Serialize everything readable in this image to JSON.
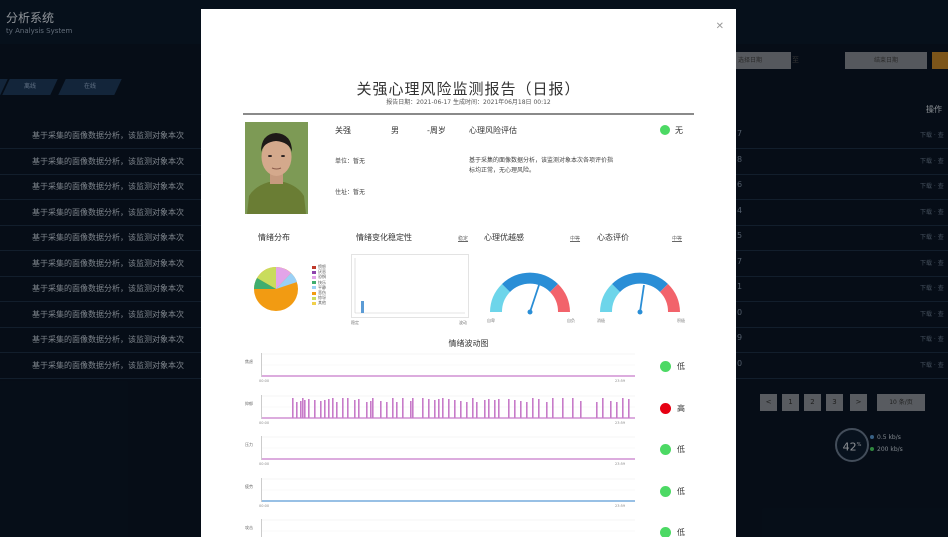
{
  "app": {
    "title": "分析系统",
    "subtitle": "ty Analysis System"
  },
  "tabs": [
    "",
    "离线",
    "在线"
  ],
  "date_filter": {
    "start": "选择日期",
    "separator": "至",
    "end": "结束日期"
  },
  "table": {
    "ops_header": "操作",
    "rows": [
      {
        "text": "基于采集的面像数据分析，该监测对象本次",
        "num": "7",
        "action": "下载 · 查"
      },
      {
        "text": "基于采集的面像数据分析，该监测对象本次",
        "num": "8",
        "action": "下载 · 查"
      },
      {
        "text": "基于采集的面像数据分析，该监测对象本次",
        "num": "6",
        "action": "下载 · 查"
      },
      {
        "text": "基于采集的面像数据分析，该监测对象本次",
        "num": "4",
        "action": "下载 · 查"
      },
      {
        "text": "基于采集的面像数据分析，该监测对象本次",
        "num": "5",
        "action": "下载 · 查"
      },
      {
        "text": "基于采集的面像数据分析，该监测对象本次",
        "num": "7",
        "action": "下载 · 查"
      },
      {
        "text": "基于采集的面像数据分析，该监测对象本次",
        "num": "1",
        "action": "下载 · 查"
      },
      {
        "text": "基于采集的面像数据分析，该监测对象本次",
        "num": "0",
        "action": "下载 · 查"
      },
      {
        "text": "基于采集的面像数据分析，该监测对象本次",
        "num": "9",
        "action": "下载 · 查"
      },
      {
        "text": "基于采集的面像数据分析，该监测对象本次",
        "num": "0",
        "action": "下载 · 查"
      }
    ]
  },
  "pagination": {
    "pages": [
      "1",
      "2",
      "3"
    ],
    "next": ">",
    "page_size": "10 条/页",
    "prev_label": "<"
  },
  "stats": {
    "circle_value": "42",
    "circle_unit": "%",
    "line1": "0.5 kb/s",
    "line2": "200 kb/s"
  },
  "report": {
    "title": "关强心理风险监测报告（日报）",
    "meta": "报告日期：2021-06-17  生成时间：2021年06月18日 00:12",
    "name": "关强",
    "gender": "男",
    "age": "-周岁",
    "risk_label": "心理风险评估",
    "risk_level": "无",
    "unit": "单位：暂无",
    "address": "住址：暂无",
    "summary_line1": "基于采集的面像数据分析，该监测对象本次各项评价指",
    "summary_line2": "标均正常，无心理风险。",
    "sections": {
      "emotion_dist": "情绪分布",
      "stability": "情绪变化稳定性",
      "stability_link": "稳定",
      "advantage": "心理优越感",
      "advantage_link": "中等",
      "mood": "心态评价",
      "mood_link": "中等"
    },
    "legend": [
      "愤怒",
      "厌恶",
      "恐惧",
      "快乐",
      "平静",
      "悲伤",
      "惊讶",
      "其他"
    ],
    "stab_axis": {
      "left": "稳定",
      "right": "波动"
    },
    "gauge1": {
      "left": "自卑",
      "right": "自负"
    },
    "gauge2": {
      "left": "消极",
      "right": "积极"
    },
    "wave_title": "情绪波动图",
    "waves": [
      {
        "name": "焦虑",
        "level": "低",
        "color": "#4cd964",
        "line": "#c77bc9",
        "t0": "00:00",
        "t1": "23:59"
      },
      {
        "name": "抑郁",
        "level": "高",
        "color": "#e60012",
        "line": "#c77bc9",
        "t0": "00:00",
        "t1": "23:59"
      },
      {
        "name": "压力",
        "level": "低",
        "color": "#4cd964",
        "line": "#c77bc9",
        "t0": "00:00",
        "t1": "23:59"
      },
      {
        "name": "疲劳",
        "level": "低",
        "color": "#4cd964",
        "line": "#5b9bd5",
        "t0": "00:00",
        "t1": "23:59"
      },
      {
        "name": "攻击",
        "level": "低",
        "color": "#4cd964",
        "line": "#c77bc9",
        "t0": "00:00",
        "t1": "23:59"
      }
    ]
  }
}
